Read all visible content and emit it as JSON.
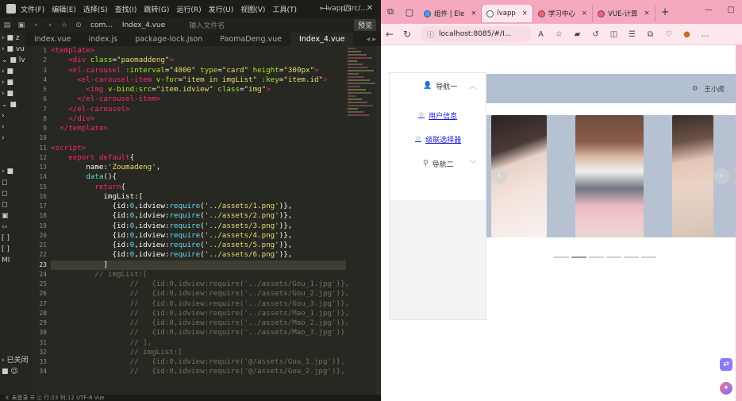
{
  "editor": {
    "menu": [
      "文件(F)",
      "编辑(E)",
      "选择(S)",
      "查找(I)",
      "跳转(G)",
      "运行(R)",
      "发行(U)",
      "视图(V)",
      "工具(T)"
    ],
    "path": "» lvapp/src/...",
    "toolbar": {
      "crumb": "com...",
      "file": "Index_4.vue",
      "filter_placeholder": "输入文件名",
      "preview": "预览"
    },
    "tabs": [
      "index.vue",
      "index.js",
      "package-lock.json",
      "PaomaDeng.vue",
      "Index_4.vue"
    ],
    "active_tab": "Index_4.vue",
    "sidebar": [
      {
        "label": "› ■ z"
      },
      {
        "label": "› ■ vu"
      },
      {
        "label": "⌄ ■ lv"
      },
      {
        "label": "  › ■"
      },
      {
        "label": "  › ■"
      },
      {
        "label": "  › ■"
      },
      {
        "label": "  ⌄ ■"
      },
      {
        "label": "     ›"
      },
      {
        "label": "     ›"
      },
      {
        "label": "     ›"
      },
      {
        "label": ""
      },
      {
        "label": ""
      },
      {
        "label": "› ■"
      },
      {
        "label": "  ◻"
      },
      {
        "label": "  ◻"
      },
      {
        "label": "  ◻"
      },
      {
        "label": "  ▣"
      },
      {
        "label": "  ‹›"
      },
      {
        "label": "  [ ]"
      },
      {
        "label": "  [ ]"
      },
      {
        "label": "  MI"
      },
      {
        "label": ""
      },
      {
        "label": ""
      },
      {
        "label": ""
      },
      {
        "label": ""
      },
      {
        "label": ""
      },
      {
        "label": ""
      },
      {
        "label": ""
      },
      {
        "label": ""
      },
      {
        "label": "› 已关闭"
      },
      {
        "label": "■ ☺"
      }
    ],
    "status": "① 未登录       ☰  ◫                                       行:23  列:12   UTF-8   Vue",
    "current_line": 23,
    "lines": [
      {
        "n": "1",
        "html": "<span class='tag'>&lt;template&gt;</span>"
      },
      {
        "n": "2",
        "html": "    <span class='tag'>&lt;div</span> <span class='attr'>class</span>=<span class='str'>\"paomaddeng\"</span><span class='tag'>&gt;</span>"
      },
      {
        "n": "3",
        "html": "    <span class='tag'>&lt;el-carousel</span> <span class='attr'>:interval</span>=<span class='str'>\"4000\"</span> <span class='attr'>type</span>=<span class='str'>\"card\"</span> <span class='attr'>height</span>=<span class='str'>\"300px\"</span><span class='tag'>&gt;</span>"
      },
      {
        "n": "4",
        "html": "      <span class='tag'>&lt;el-carousel-item</span> <span class='attr'>v-for</span>=<span class='str'>\"item in imgList\"</span> <span class='attr'>:key</span>=<span class='str'>\"item.id\"</span><span class='tag'>&gt;</span>"
      },
      {
        "n": "5",
        "html": "        <span class='tag'>&lt;img</span> <span class='attr'>v-bind:src</span>=<span class='str'>\"item.idview\"</span> <span class='attr'>class</span>=<span class='str'>\"img\"</span><span class='tag'>&gt;</span>"
      },
      {
        "n": "6",
        "html": "      <span class='tag'>&lt;/el-carousel-item&gt;</span>"
      },
      {
        "n": "7",
        "html": "    <span class='tag'>&lt;/el-carousel&gt;</span>"
      },
      {
        "n": "8",
        "html": "    <span class='tag'>&lt;/div&gt;</span>"
      },
      {
        "n": "9",
        "html": "  <span class='tag'>&lt;/template&gt;</span>"
      },
      {
        "n": "10",
        "html": ""
      },
      {
        "n": "11",
        "html": "<span class='tag'>&lt;script&gt;</span>"
      },
      {
        "n": "12",
        "html": "    <span class='kw'>export default</span>{"
      },
      {
        "n": "13",
        "html": "        name:<span class='str'>'Zoumadeng'</span>,"
      },
      {
        "n": "14",
        "html": "        <span class='fn'>data</span>(){"
      },
      {
        "n": "15",
        "html": "          <span class='kw'>return</span>{"
      },
      {
        "n": "16",
        "html": "            imgList:["
      },
      {
        "n": "17",
        "html": "              {id:<span class='fn'>0</span>,idview:<span class='fn'>require</span>(<span class='str'>'../assets/1.png'</span>)},"
      },
      {
        "n": "18",
        "html": "              {id:<span class='fn'>0</span>,idview:<span class='fn'>require</span>(<span class='str'>'../assets/2.png'</span>)},"
      },
      {
        "n": "19",
        "html": "              {id:<span class='fn'>0</span>,idview:<span class='fn'>require</span>(<span class='str'>'../assets/3.png'</span>)},"
      },
      {
        "n": "20",
        "html": "              {id:<span class='fn'>0</span>,idview:<span class='fn'>require</span>(<span class='str'>'../assets/4.png'</span>)},"
      },
      {
        "n": "21",
        "html": "              {id:<span class='fn'>0</span>,idview:<span class='fn'>require</span>(<span class='str'>'../assets/5.png'</span>)},"
      },
      {
        "n": "22",
        "html": "              {id:<span class='fn'>0</span>,idview:<span class='fn'>require</span>(<span class='str'>'../assets/6.png'</span>)},"
      },
      {
        "n": "23",
        "html": "            ]"
      },
      {
        "n": "24",
        "html": "          <span class='cm'>// imgList:[</span>"
      },
      {
        "n": "25",
        "html": "<span class='cm'>                  //   {id:0,idview:require('../assets/Gou_1.jpg')},</span>"
      },
      {
        "n": "26",
        "html": "<span class='cm'>                  //   {id:0,idview:require('../assets/Gou_2.jpg')},</span>"
      },
      {
        "n": "27",
        "html": "<span class='cm'>                  //   {id:0,idview:require('../assets/Gou_3.jpg')},</span>"
      },
      {
        "n": "28",
        "html": "<span class='cm'>                  //   {id:0,idview:require('../assets/Mao_1.jpg')},</span>"
      },
      {
        "n": "29",
        "html": "<span class='cm'>                  //   {id:0,idview:require('../assets/Mao_2.jpg')},</span>"
      },
      {
        "n": "30",
        "html": "<span class='cm'>                  //   {id:0,idview:require('../assets/Mao_3.jpg')}</span>"
      },
      {
        "n": "31",
        "html": "<span class='cm'>                  // ],</span>"
      },
      {
        "n": "32",
        "html": "<span class='cm'>                  // imgList:[</span>"
      },
      {
        "n": "33",
        "html": "<span class='cm'>                  //   {id:0,idview:require('@/assets/Gou_1.jpg')},</span>"
      },
      {
        "n": "34",
        "html": "<span class='cm'>                  //   {id:0,idview:require('@/assets/Gou_2.jpg')},</span>"
      }
    ]
  },
  "browser": {
    "tabs": [
      {
        "label": "组件 | Ele",
        "fav": "#409eff",
        "active": false
      },
      {
        "label": "lvapp",
        "fav": "#ffffff",
        "active": true
      },
      {
        "label": "学习中心",
        "fav": "#ff5a7a",
        "active": false
      },
      {
        "label": "VUE-计算",
        "fav": "#ff5a7a",
        "active": false
      }
    ],
    "tab_close": "×",
    "new_tab": "+",
    "url": "localhost:8085/#/I...",
    "window_controls": [
      "—",
      "□"
    ]
  },
  "page": {
    "menu": {
      "nav1": "导航一",
      "user_info": "用户信息",
      "cascader": "级联选择器",
      "nav2": "导航二"
    },
    "header_user": "王小虎",
    "carousel": {
      "arrow_left": "‹",
      "arrow_right": "›",
      "indicator_count": 6,
      "active_index": 1
    }
  }
}
